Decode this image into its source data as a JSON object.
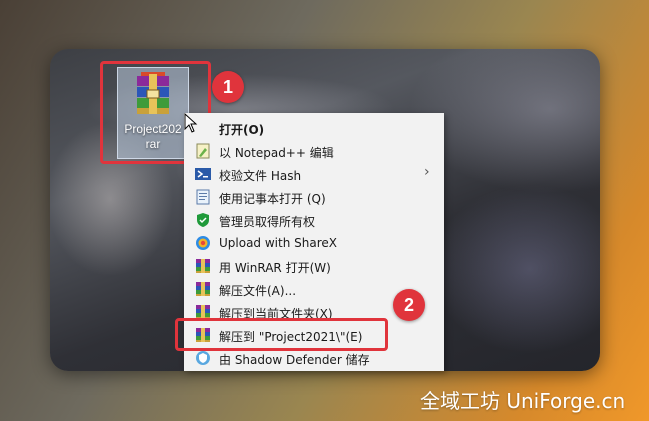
{
  "desktop_icon": {
    "name_line1": "Project202",
    "name_line2": "rar"
  },
  "callouts": {
    "one": "1",
    "two": "2"
  },
  "context_menu": {
    "items": [
      {
        "label": "打开(O)",
        "icon": "winrar-icon",
        "bold": true
      },
      {
        "label": "以 Notepad++ 编辑",
        "icon": "notepadpp-icon"
      },
      {
        "label": "校验文件 Hash",
        "icon": "powershell-icon",
        "submenu": true
      },
      {
        "label": "使用记事本打开 (Q)",
        "icon": "notepad-icon"
      },
      {
        "label": "管理员取得所有权",
        "icon": "shield-icon"
      },
      {
        "label": "Upload with ShareX",
        "icon": "sharex-icon"
      },
      {
        "label": "用 WinRAR 打开(W)",
        "icon": "winrar-icon"
      },
      {
        "label": "解压文件(A)...",
        "icon": "winrar-icon"
      },
      {
        "label": "解压到当前文件夹(X)",
        "icon": "winrar-icon"
      },
      {
        "label": "解压到 \"Project2021\\\"(E)",
        "icon": "winrar-icon"
      },
      {
        "label": "由 Shadow Defender 储存",
        "icon": "shadow-defender-icon"
      }
    ],
    "submenu_arrow": "›"
  },
  "watermark": "全域工坊 UniForge.cn",
  "colors": {
    "callout_red": "#e0343c",
    "menu_bg": "#f2f2f2",
    "selection": "#cce8ff"
  }
}
